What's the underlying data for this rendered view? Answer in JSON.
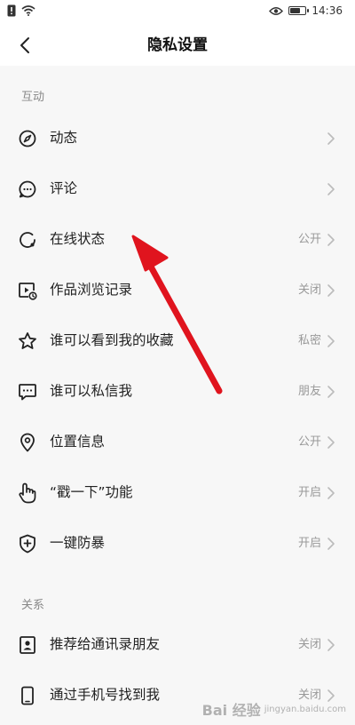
{
  "status_bar": {
    "time": "14:36"
  },
  "nav": {
    "title": "隐私设置"
  },
  "sections": [
    {
      "header": "互动",
      "items": [
        {
          "label": "动态",
          "value": "",
          "icon": "compass-icon"
        },
        {
          "label": "评论",
          "value": "",
          "icon": "comment-icon"
        },
        {
          "label": "在线状态",
          "value": "公开",
          "icon": "online-status-icon"
        },
        {
          "label": "作品浏览记录",
          "value": "关闭",
          "icon": "video-history-icon"
        },
        {
          "label": "谁可以看到我的收藏",
          "value": "私密",
          "icon": "star-icon"
        },
        {
          "label": "谁可以私信我",
          "value": "朋友",
          "icon": "message-icon"
        },
        {
          "label": "位置信息",
          "value": "公开",
          "icon": "location-icon"
        },
        {
          "label": "“戳一下”功能",
          "value": "开启",
          "icon": "poke-hand-icon"
        },
        {
          "label": "一键防暴",
          "value": "开启",
          "icon": "shield-plus-icon"
        }
      ]
    },
    {
      "header": "关系",
      "items": [
        {
          "label": "推荐给通讯录朋友",
          "value": "关闭",
          "icon": "contact-icon"
        },
        {
          "label": "通过手机号找到我",
          "value": "关闭",
          "icon": "phone-icon"
        }
      ]
    }
  ],
  "colors": {
    "annotation_arrow": "#e0141e"
  },
  "watermark": {
    "brand": "Bai 经验",
    "sub": "jingyan.baidu.com"
  }
}
